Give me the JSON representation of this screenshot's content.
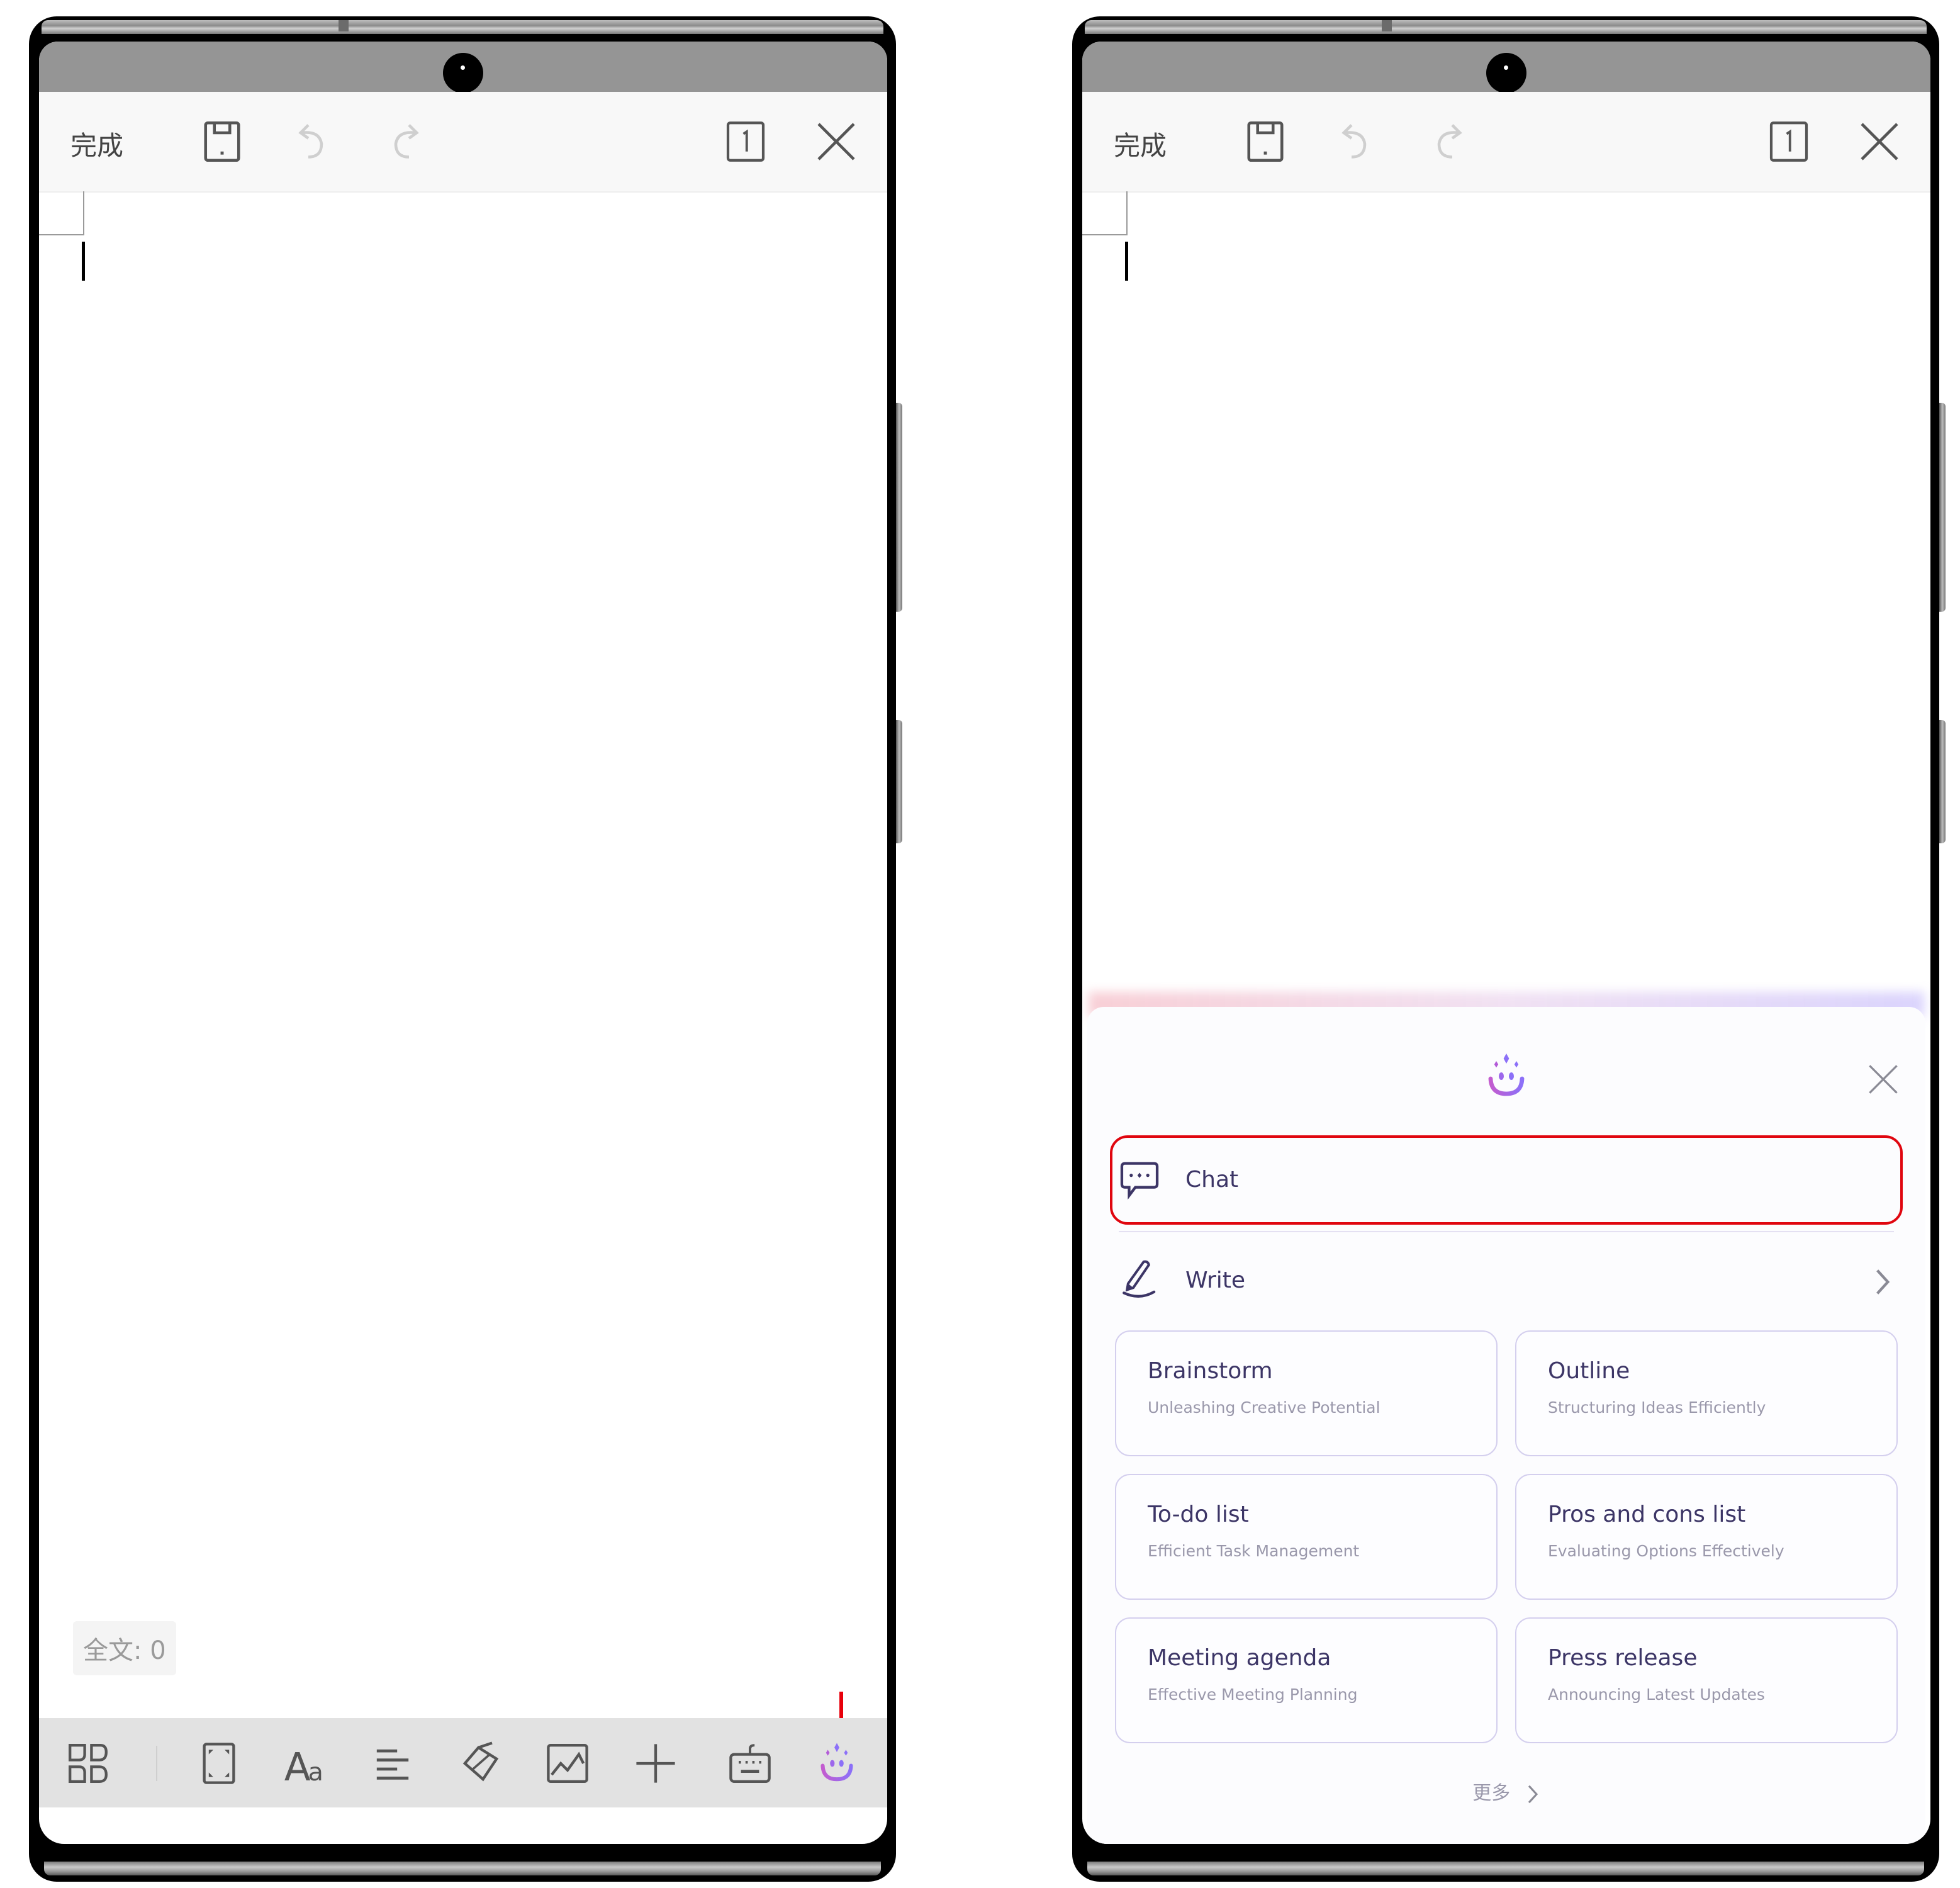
{
  "left_screen": {
    "top_toolbar": {
      "done_label": "完成",
      "icons": [
        "save-icon",
        "undo-icon",
        "redo-icon",
        "page-count-icon",
        "close-icon"
      ],
      "page_count": "1"
    },
    "word_count": "全文: 0",
    "bottom_toolbar": {
      "icons": [
        "apps-icon",
        "page-layout-icon",
        "text-format-icon",
        "align-icon",
        "eraser-icon",
        "image-icon",
        "insert-icon",
        "keyboard-icon",
        "ai-assistant-icon"
      ]
    },
    "annotation": {
      "arrow_color": "#e8000b",
      "target": "ai-assistant-icon"
    }
  },
  "right_screen": {
    "top_toolbar": {
      "done_label": "完成",
      "page_count": "1"
    },
    "ai_panel": {
      "logo_icon": "ai-assistant-icon",
      "close_icon": "close-icon",
      "chat_label": "Chat",
      "write_label": "Write",
      "highlight_color": "#e0060f",
      "cards": [
        {
          "title": "Brainstorm",
          "subtitle": "Unleashing Creative Potential"
        },
        {
          "title": "Outline",
          "subtitle": "Structuring Ideas Efficiently"
        },
        {
          "title": "To-do list",
          "subtitle": "Efficient Task Management"
        },
        {
          "title": "Pros and cons list",
          "subtitle": "Evaluating Options Effectively"
        },
        {
          "title": "Meeting agenda",
          "subtitle": "Effective Meeting Planning"
        },
        {
          "title": "Press release",
          "subtitle": "Announcing Latest Updates"
        }
      ],
      "more_label": "更多"
    }
  },
  "colors": {
    "text_dark": "#3c3566",
    "text_muted": "#9a98ab",
    "ai_gradient_start": "#c160d8",
    "ai_gradient_end": "#8b6cf6",
    "card_border": "#d4cfee"
  }
}
